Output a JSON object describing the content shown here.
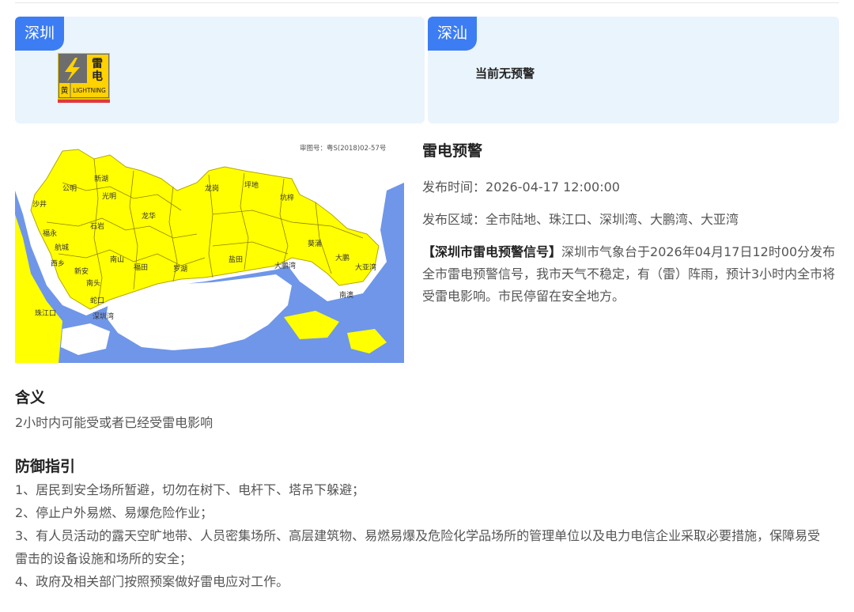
{
  "cards": [
    {
      "city": "深圳",
      "signal": {
        "icon": "lightning-warning-yellow-icon",
        "char_top": "雷",
        "char_bottom": "电",
        "level": "黄",
        "label": "LIGHTNING"
      }
    },
    {
      "city": "深汕",
      "status_text": "当前无预警"
    }
  ],
  "map": {
    "approval_no": "审图号：粤S(2018)02-57号",
    "labels": [
      "光明",
      "龙岗",
      "坪地",
      "新湖",
      "石岩",
      "龙华",
      "公明",
      "沙井",
      "福永",
      "西乡",
      "新安",
      "航城",
      "南头",
      "蛇口",
      "福田",
      "罗湖",
      "盐田",
      "南山",
      "大鹏湾",
      "大鹏",
      "大亚湾",
      "南澳",
      "葵涌",
      "珠江口",
      "深圳湾",
      "坑梓"
    ]
  },
  "warning": {
    "title": "雷电预警",
    "publish_time_label": "发布时间：",
    "publish_time": "2026-04-17 12:00:00",
    "area_label": "发布区域：",
    "area": "全市陆地、珠江口、深圳湾、大鹏湾、大亚湾",
    "desc_title": "【深圳市雷电预警信号】",
    "desc_body": "深圳市气象台于2026年04月17日12时00分发布全市雷电预警信号，我市天气不稳定，有（雷）阵雨，预计3小时内全市将受雷电影响。市民停留在安全地方。"
  },
  "meaning": {
    "title": "含义",
    "text": "2小时内可能受或者已经受雷电影响"
  },
  "guide": {
    "title": "防御指引",
    "items": [
      "1、居民到安全场所暂避，切勿在树下、电杆下、塔吊下躲避；",
      "2、停止户外易燃、易爆危险作业；",
      "3、有人员活动的露天空旷地带、人员密集场所、高层建筑物、易燃易爆及危险化学品场所的管理单位以及电力电信企业采取必要措施，保障易受雷击的设备设施和场所的安全；",
      "4、政府及相关部门按照预案做好雷电应对工作。"
    ]
  },
  "colors": {
    "accent": "#3d7df3",
    "card_bg": "#eaf4fd",
    "warning_yellow": "#ffff00",
    "sea_blue": "#6f96e8",
    "signal_gray": "#6d6d6d",
    "signal_red": "#e03a3a"
  }
}
